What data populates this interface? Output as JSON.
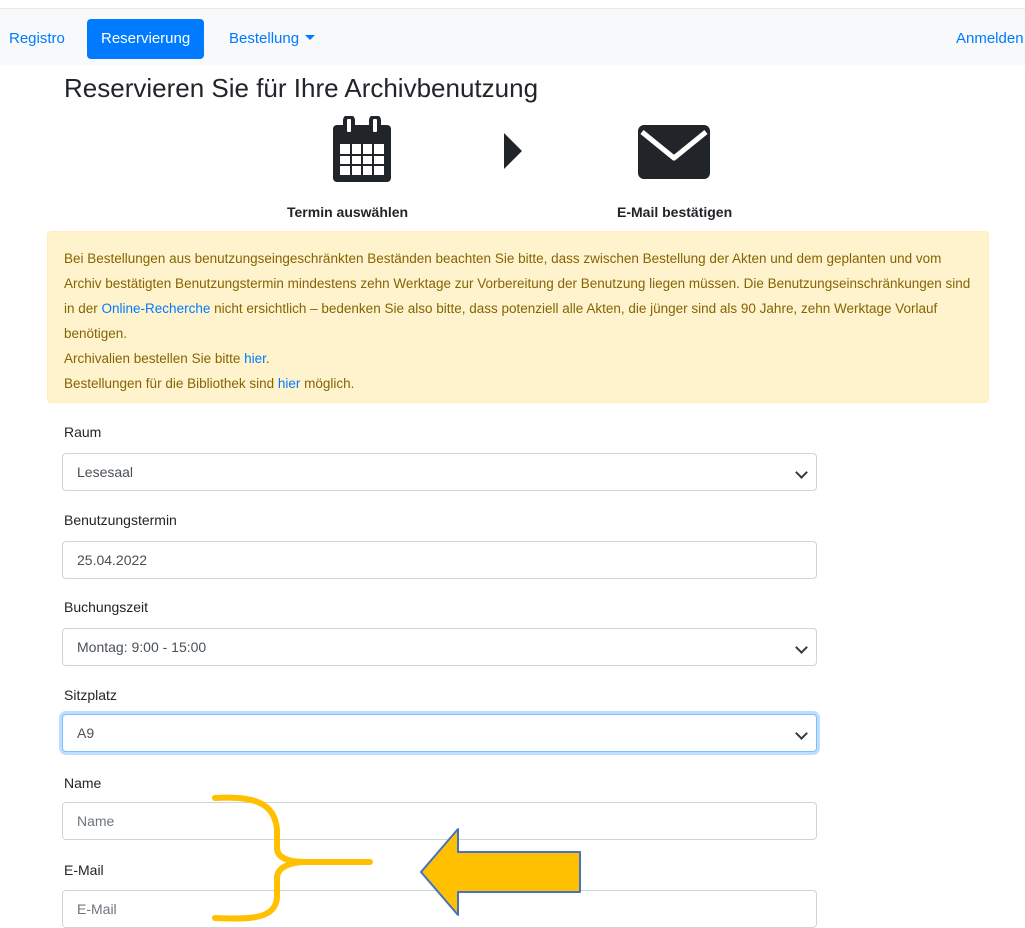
{
  "nav": {
    "items": [
      {
        "label": "Registro"
      },
      {
        "label": "Reservierung"
      },
      {
        "label": "Bestellung"
      }
    ],
    "login_label": "Anmelden"
  },
  "page_title": "Reservieren Sie für Ihre Archivbenutzung",
  "steps": {
    "step1_label": "Termin auswählen",
    "step2_label": "E-Mail bestätigen"
  },
  "notice": {
    "p1_part1": "Bei Bestellungen aus benutzungseingeschränkten Beständen beachten Sie bitte, dass zwischen Bestellung der Akten und dem geplanten und vom Archiv bestätigten Benutzungstermin mindestens zehn Werktage zur Vorbereitung der Benutzung liegen müssen. Die Benutzungseinschränkungen sind in der ",
    "p1_link": "Online-Recherche",
    "p1_part2": " nicht ersichtlich – bedenken Sie also bitte, dass potenziell alle Akten, die jünger sind als 90 Jahre, zehn Werktage Vorlauf benötigen.",
    "p2_part1": "Archivalien bestellen Sie bitte ",
    "p2_link": "hier",
    "p2_part2": ".",
    "p3_part1": "Bestellungen für die Bibliothek sind ",
    "p3_link": "hier",
    "p3_part2": " möglich."
  },
  "form": {
    "room": {
      "label": "Raum",
      "value": "Lesesaal"
    },
    "date": {
      "label": "Benutzungstermin",
      "value": "25.04.2022"
    },
    "time": {
      "label": "Buchungszeit",
      "value": "Montag: 9:00 - 15:00"
    },
    "seat": {
      "label": "Sitzplatz",
      "value": "A9"
    },
    "name": {
      "label": "Name",
      "placeholder": "Name"
    },
    "email": {
      "label": "E-Mail",
      "placeholder": "E-Mail"
    }
  },
  "colors": {
    "primary": "#007bff",
    "alert_bg": "#fff3cd",
    "alert_text": "#856404",
    "annotation": "#ffc000",
    "annotation_outline": "#4472c4"
  }
}
